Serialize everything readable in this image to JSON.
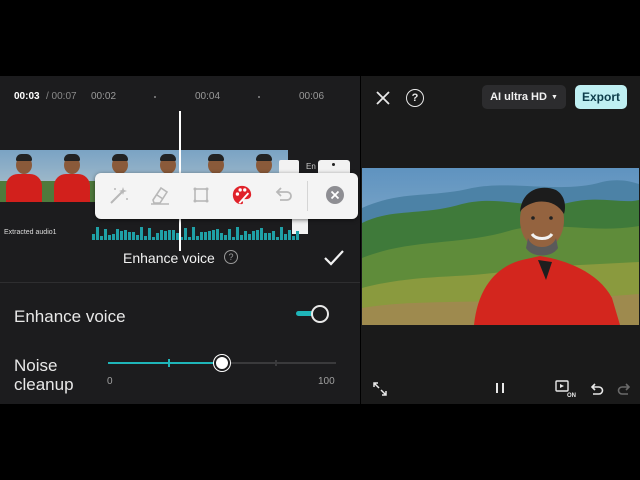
{
  "editor": {
    "timecode_current": "00:03",
    "timecode_total": " / 00:07",
    "ruler_ticks": [
      "00:02",
      "00:04",
      "00:06"
    ],
    "strip_tag_label": "En",
    "audio_track_label": "Extracted audio1",
    "enhance_panel": {
      "title": "Enhance voice",
      "help_symbol": "?",
      "toggle_label": "Enhance voice",
      "toggle_on": true,
      "noise_label_line1": "Noise",
      "noise_label_line2": "cleanup",
      "slider_min": "0",
      "slider_max": "100",
      "slider_value_fraction": 0.5
    },
    "toolbar_tools": [
      "magic-brush-icon",
      "eraser-icon",
      "crop-icon",
      "palette-icon",
      "undo-icon",
      "close-icon"
    ]
  },
  "preview": {
    "help_symbol": "?",
    "quality_label": "AI ultra HD",
    "export_label": "Export",
    "audio_badge": "ON"
  },
  "colors": {
    "accent": "#1fb5b9",
    "export_bg": "#bfeff2",
    "palette_red": "#e0222a"
  }
}
